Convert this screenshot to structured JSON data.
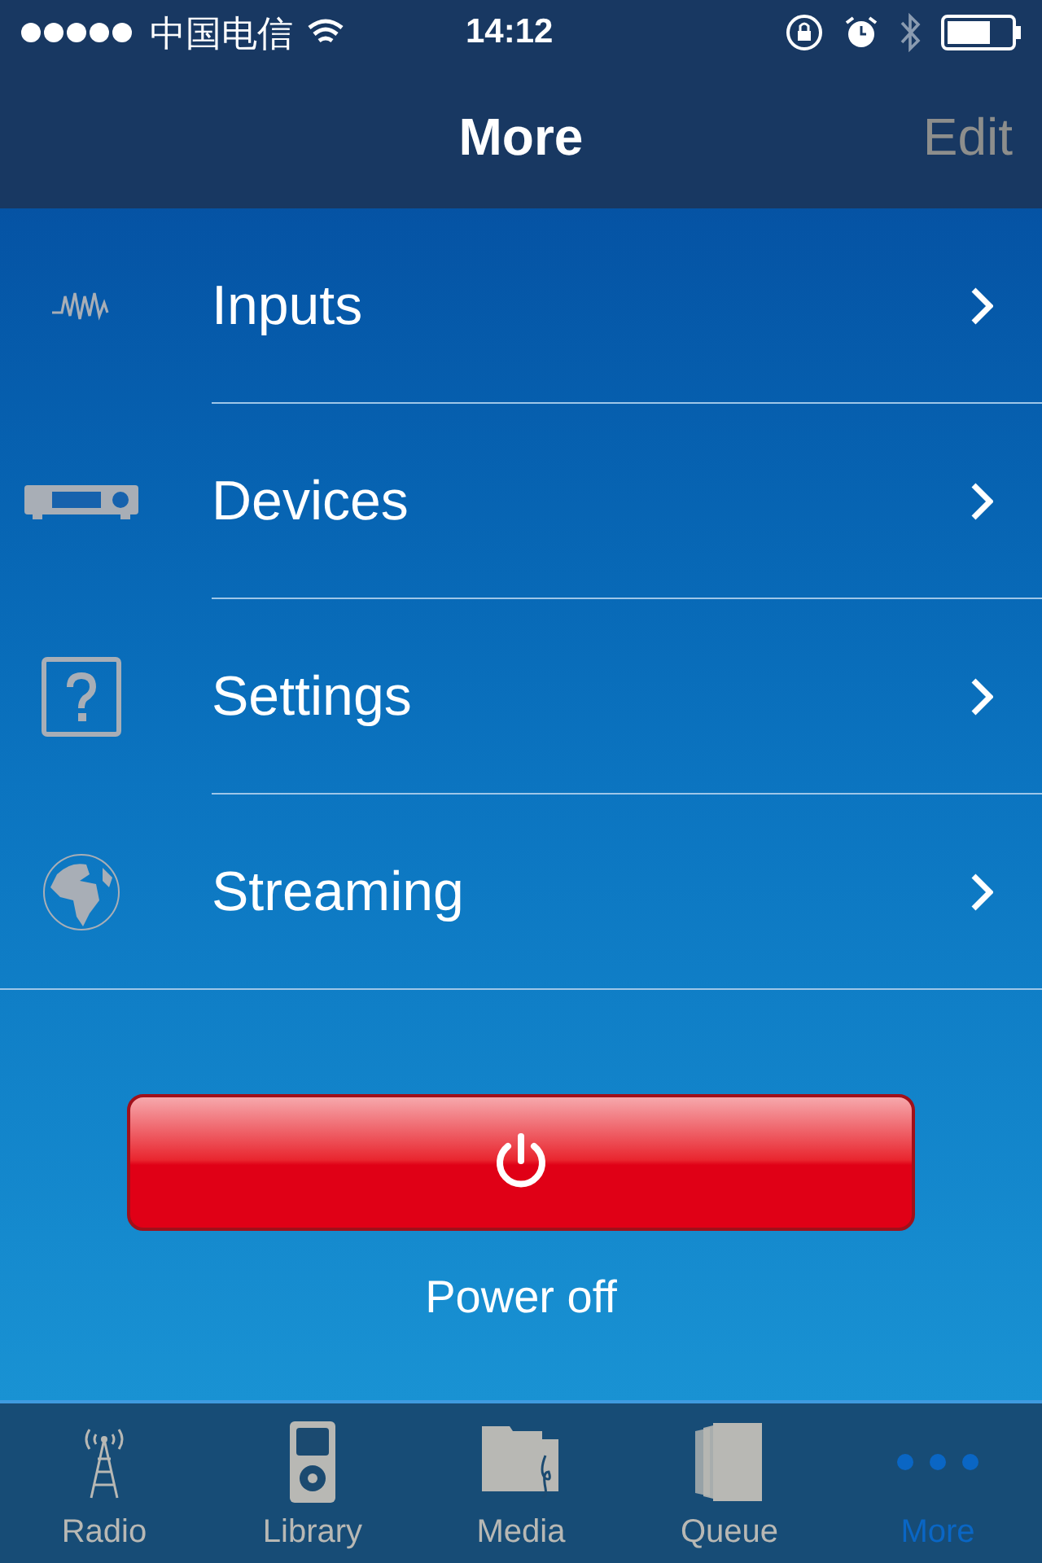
{
  "status_bar": {
    "carrier": "中国电信",
    "time": "14:12"
  },
  "nav": {
    "title": "More",
    "edit": "Edit"
  },
  "items": [
    {
      "label": "Inputs",
      "kind": "wave"
    },
    {
      "label": "Devices",
      "kind": "device"
    },
    {
      "label": "Settings",
      "kind": "help"
    },
    {
      "label": "Streaming",
      "kind": "globe"
    }
  ],
  "power": {
    "label": "Power off"
  },
  "tabs": [
    {
      "label": "Radio",
      "kind": "radio",
      "selected": false
    },
    {
      "label": "Library",
      "kind": "library",
      "selected": false
    },
    {
      "label": "Media",
      "kind": "media",
      "selected": false
    },
    {
      "label": "Queue",
      "kind": "queue",
      "selected": false
    },
    {
      "label": "More",
      "kind": "more",
      "selected": true
    }
  ]
}
